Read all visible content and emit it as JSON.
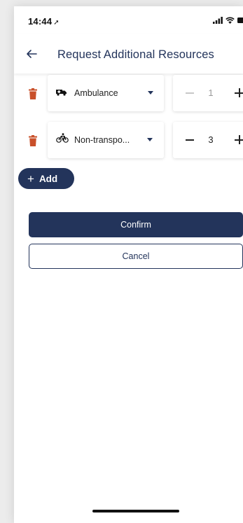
{
  "status_bar": {
    "time": "14:44",
    "location_glyph": "➚",
    "icons": [
      "signal-bars-icon",
      "wifi-icon",
      "battery-icon"
    ]
  },
  "header": {
    "back_icon": "arrow-left-icon",
    "title": "Request Additional Resources"
  },
  "resources": [
    {
      "icon": "ambulance-icon",
      "label": "Ambulance",
      "quantity": "1",
      "minus_enabled": false
    },
    {
      "icon": "bicycle-icon",
      "label": "Non-transpo...",
      "quantity": "3",
      "minus_enabled": true
    }
  ],
  "actions": {
    "add_label": "Add",
    "confirm_label": "Confirm",
    "cancel_label": "Cancel"
  },
  "colors": {
    "primary": "#23345b",
    "danger": "#c9502a",
    "disabled": "#c8c8c8"
  }
}
